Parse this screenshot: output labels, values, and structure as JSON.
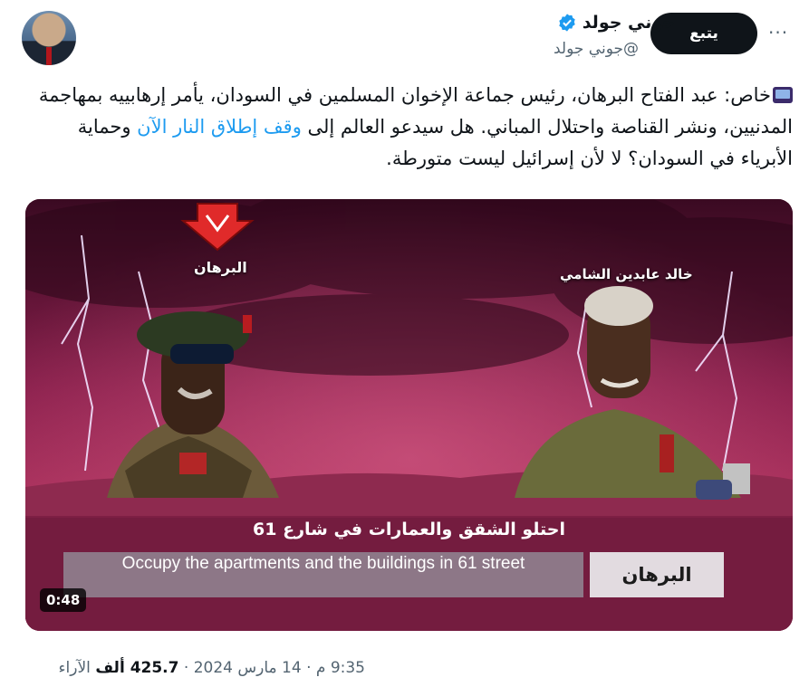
{
  "author": {
    "name": "جوني جولد",
    "handle": "@جوني جولد"
  },
  "follow_label": "يتبع",
  "more_label": "···",
  "tweet": {
    "text_main": "خاص: عبد الفتاح البرهان، رئيس جماعة الإخوان المسلمين في السودان، يأمر إرهابييه بمهاجمة المدنيين، ونشر القناصة واحتلال المباني. هل سيدعو العالم إلى ",
    "link_text": "وقف إطلاق النار الآن",
    "text_end": " وحماية الأبرياء في السودان؟ لا لأن إسرائيل ليست متورطة."
  },
  "media": {
    "label_left": "البرهان",
    "label_right": "خالد عابدين الشامي",
    "arabic_subtitle": "احتلو الشقق والعمارات في شارع 61",
    "english_subtitle": "Occupy  the apartments and the buildings in 61 street",
    "speaker_box": "البرهان",
    "duration": "0:48"
  },
  "footer": {
    "time": "9:35 م",
    "date": "14 مارس 2024",
    "views_count": "425.7 ألف",
    "views_label": "الآراء"
  },
  "colors": {
    "link": "#1d9bf0",
    "verified": "#1d9bf0",
    "follow_bg": "#0f1419"
  }
}
